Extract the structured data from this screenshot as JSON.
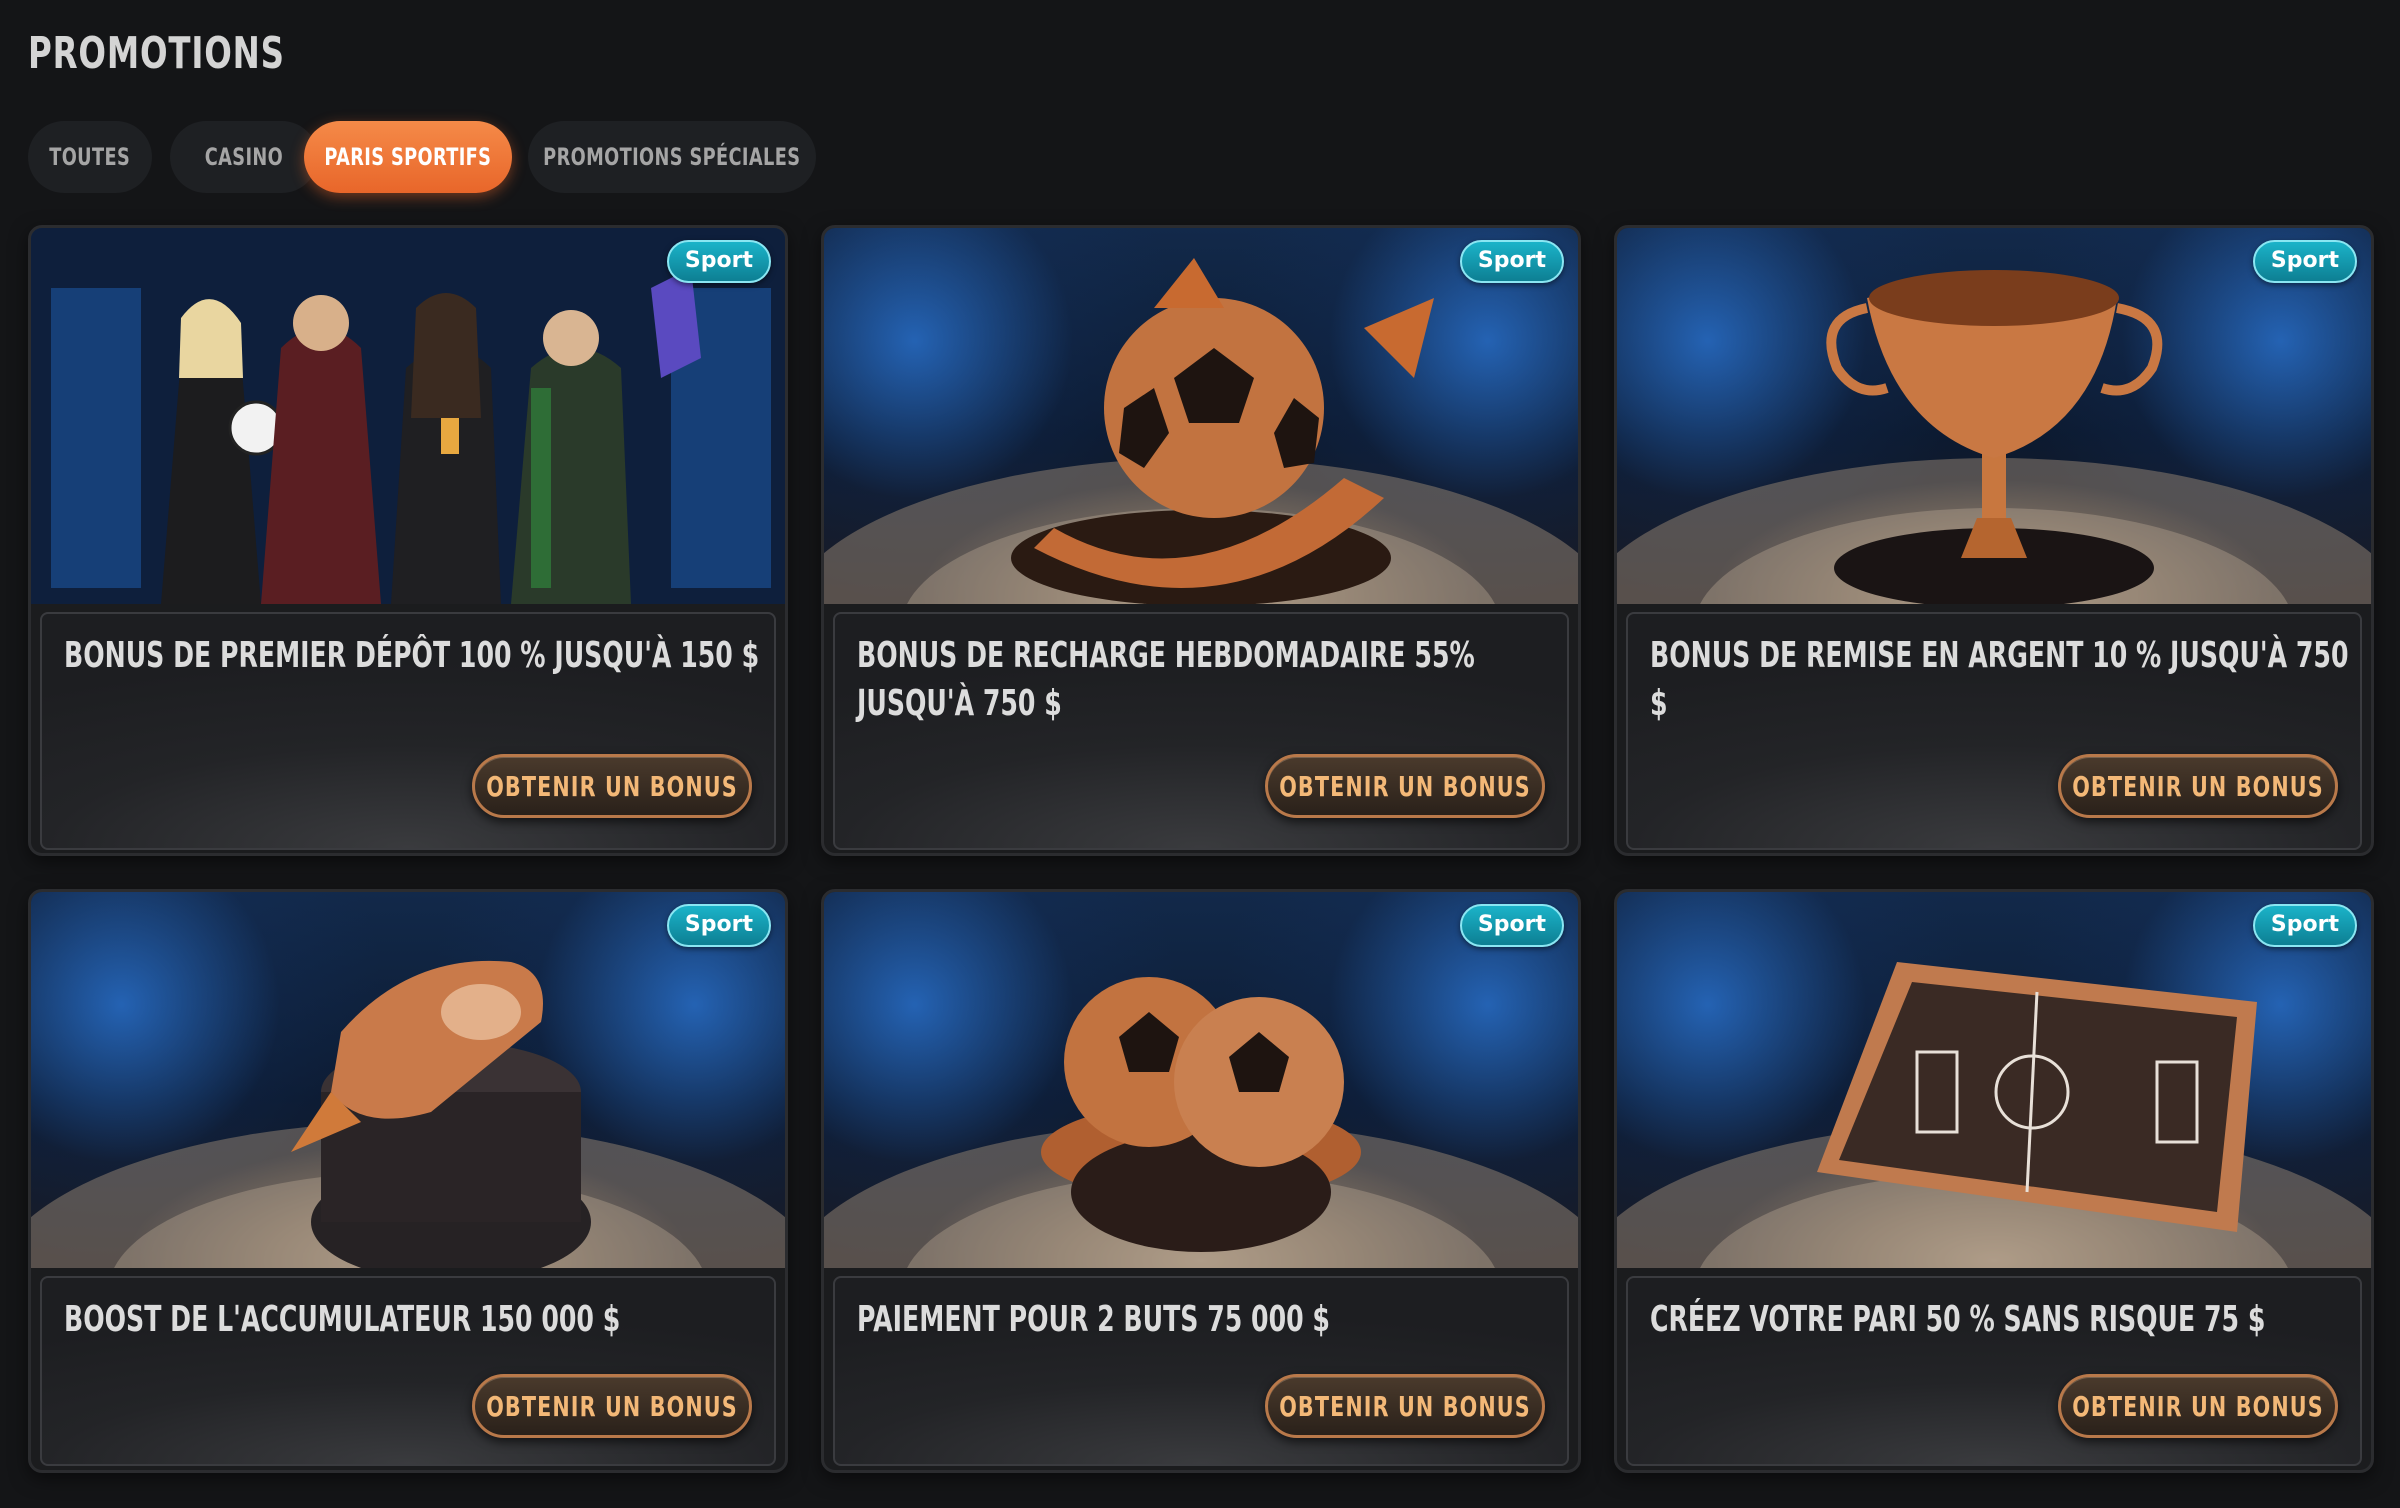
{
  "page": {
    "title": "PROMOTIONS"
  },
  "tabs": [
    {
      "label": "TOUTES",
      "active": false
    },
    {
      "label": "CASINO",
      "active": false
    },
    {
      "label": "PARIS SPORTIFS",
      "active": true
    },
    {
      "label": "PROMOTIONS SPÉCIALES",
      "active": false
    }
  ],
  "cards": [
    {
      "badge": "Sport",
      "title": "BONUS DE PREMIER DÉPÔT 100 % JUSQU'À 150 $",
      "button": "OBTENIR UN BONUS",
      "image": "fans-celebrating-with-football"
    },
    {
      "badge": "Sport",
      "title": "BONUS DE RECHARGE HEBDOMADAIRE 55% JUSQU'À 750 $",
      "button": "OBTENIR UN BONUS",
      "image": "football-with-reload-arrows"
    },
    {
      "badge": "Sport",
      "title": "BONUS DE REMISE EN ARGENT 10 % JUSQU'À 750 $",
      "button": "OBTENIR UN BONUS",
      "image": "copper-trophy-cup"
    },
    {
      "badge": "Sport",
      "title": "BOOST DE L'ACCUMULATEUR 150 000 $",
      "button": "OBTENIR UN BONUS",
      "image": "winged-football-boot"
    },
    {
      "badge": "Sport",
      "title": "PAIEMENT POUR 2 BUTS 75 000 $",
      "button": "OBTENIR UN BONUS",
      "image": "two-footballs-on-stand"
    },
    {
      "badge": "Sport",
      "title": "CRÉEZ VOTRE PARI 50 % SANS RISQUE 75 $",
      "button": "OBTENIR UN BONUS",
      "image": "tactics-board"
    }
  ],
  "colors": {
    "accent": "#e8662a",
    "badge": "#0d7f93",
    "button_text": "#f3b877",
    "background": "#141517"
  }
}
